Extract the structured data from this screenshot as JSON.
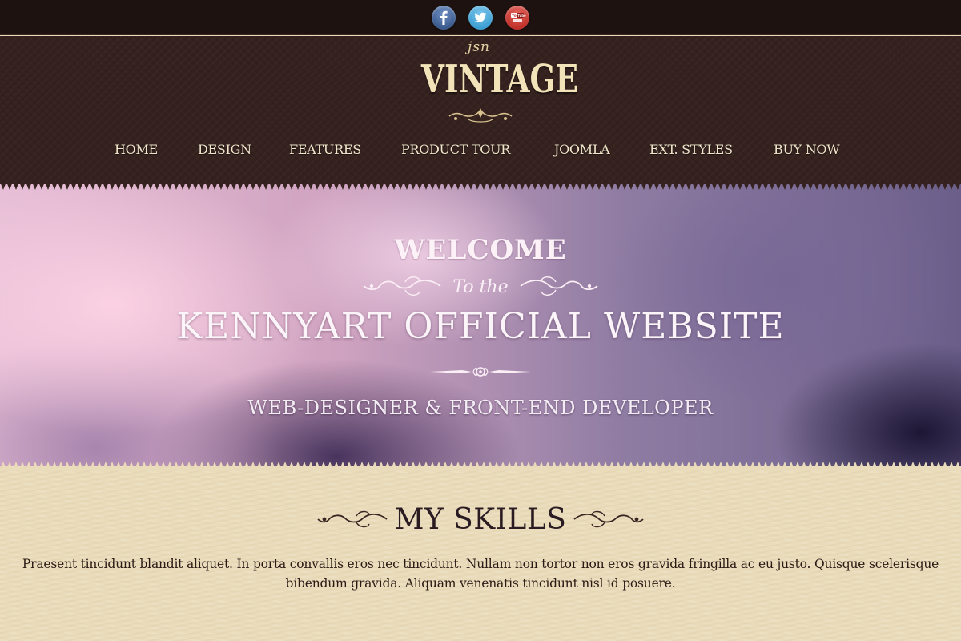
{
  "social": {
    "icons": [
      {
        "name": "facebook-icon",
        "glyph": "f",
        "color": "#3b5b8e"
      },
      {
        "name": "twitter-icon",
        "glyph": "t",
        "color": "#3c9fd3"
      },
      {
        "name": "youtube-icon",
        "glyph": "You Tube",
        "color": "#c0302a"
      }
    ]
  },
  "header": {
    "logo_small": "jsn",
    "logo_main": "VINTAGE"
  },
  "nav": {
    "items": [
      {
        "label": "HOME"
      },
      {
        "label": "DESIGN"
      },
      {
        "label": "FEATURES"
      },
      {
        "label": "PRODUCT TOUR"
      },
      {
        "label": "JOOMLA"
      },
      {
        "label": "EXT. STYLES"
      },
      {
        "label": "BUY NOW"
      }
    ]
  },
  "hero": {
    "welcome": "WELCOME",
    "to_the": "To the",
    "title": "KENNYART OFFICIAL WEBSITE",
    "subtitle": "WEB-DESIGNER & FRONT-END DEVELOPER"
  },
  "skills": {
    "title": "MY SKILLS",
    "text": "Praesent tincidunt blandit aliquet. In porta convallis eros nec tincidunt. Nullam non tortor non eros gravida fringilla ac eu justo. Quisque scelerisque bibendum gravida. Aliquam venenatis tincidunt nisl id posuere."
  },
  "colors": {
    "header_bg": "#35221f",
    "topbar_bg": "#1d1210",
    "cream_bg": "#eadcbb",
    "logo_color": "#f3e3b8"
  }
}
